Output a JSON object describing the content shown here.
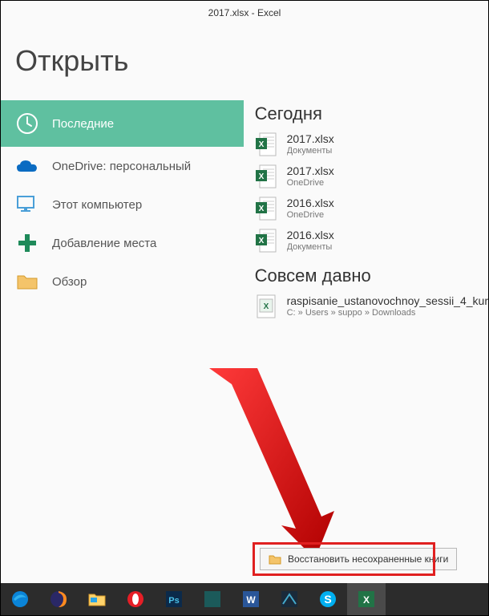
{
  "title_bar": "2017.xlsx - Excel",
  "page_title": "Открыть",
  "nav": {
    "recent": "Последние",
    "onedrive": "OneDrive: персональный",
    "this_pc": "Этот компьютер",
    "add_place": "Добавление места",
    "browse": "Обзор"
  },
  "groups": [
    {
      "heading": "Сегодня",
      "files": [
        {
          "name": "2017.xlsx",
          "sub": "Документы"
        },
        {
          "name": "2017.xlsx",
          "sub": "OneDrive"
        },
        {
          "name": "2016.xlsx",
          "sub": "OneDrive"
        },
        {
          "name": "2016.xlsx",
          "sub": "Документы"
        }
      ]
    },
    {
      "heading": "Совсем давно",
      "files": [
        {
          "name": "raspisanie_ustanovochnoy_sessii_4_kur",
          "sub": "C: » Users » suppo » Downloads"
        }
      ]
    }
  ],
  "recover_label": "Восстановить несохраненные книги",
  "colors": {
    "accent": "#5fc0a0",
    "arrow": "#e02020",
    "onedrive": "#0a6bc2",
    "add_plus": "#1f8a5a",
    "excel": "#217346"
  },
  "taskbar_items": [
    "edge",
    "firefox",
    "explorer",
    "opera",
    "photoshop",
    "unknown",
    "word",
    "app",
    "skype",
    "excel"
  ]
}
